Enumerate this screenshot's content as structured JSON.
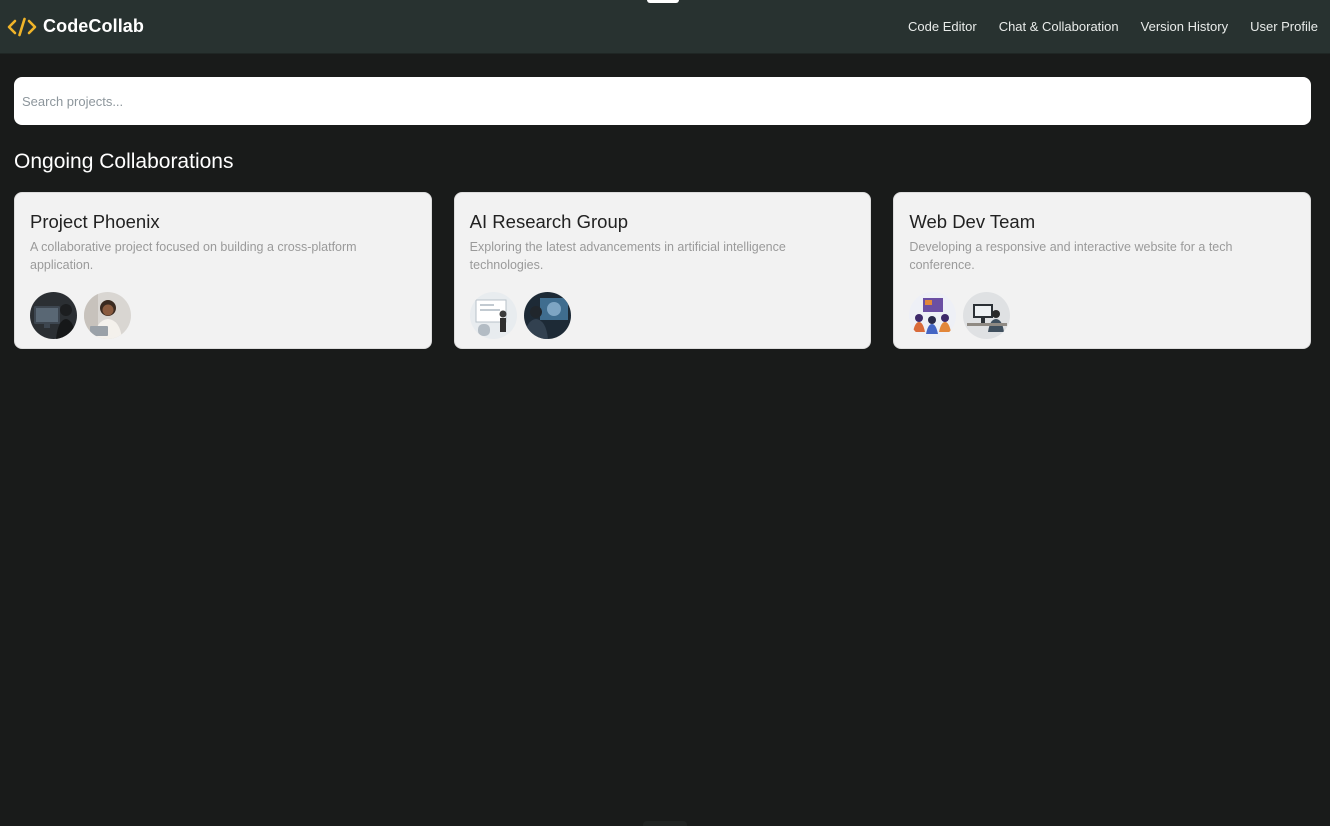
{
  "app": {
    "name": "CodeCollab",
    "logo_icon": "code-brackets-icon",
    "accent": "#f0b429"
  },
  "nav": {
    "items": [
      {
        "label": "Code Editor"
      },
      {
        "label": "Chat & Collaboration"
      },
      {
        "label": "Version History"
      },
      {
        "label": "User Profile"
      }
    ]
  },
  "search": {
    "placeholder": "Search projects...",
    "value": ""
  },
  "section": {
    "title": "Ongoing Collaborations"
  },
  "projects": [
    {
      "title": "Project Phoenix",
      "description": "A collaborative project focused on building a cross-platform application.",
      "avatars": [
        "developer-at-monitor-avatar",
        "person-with-laptop-avatar"
      ]
    },
    {
      "title": "AI Research Group",
      "description": "Exploring the latest advancements in artificial intelligence technologies.",
      "avatars": [
        "presenter-at-whiteboard-avatar",
        "researcher-with-screen-avatar"
      ]
    },
    {
      "title": "Web Dev Team",
      "description": "Developing a responsive and interactive website for a tech conference.",
      "avatars": [
        "team-meeting-avatar",
        "person-at-desk-avatar"
      ]
    }
  ],
  "colors": {
    "background": "#191b1a",
    "topbar": "#283230",
    "card": "#f2f2f2"
  }
}
